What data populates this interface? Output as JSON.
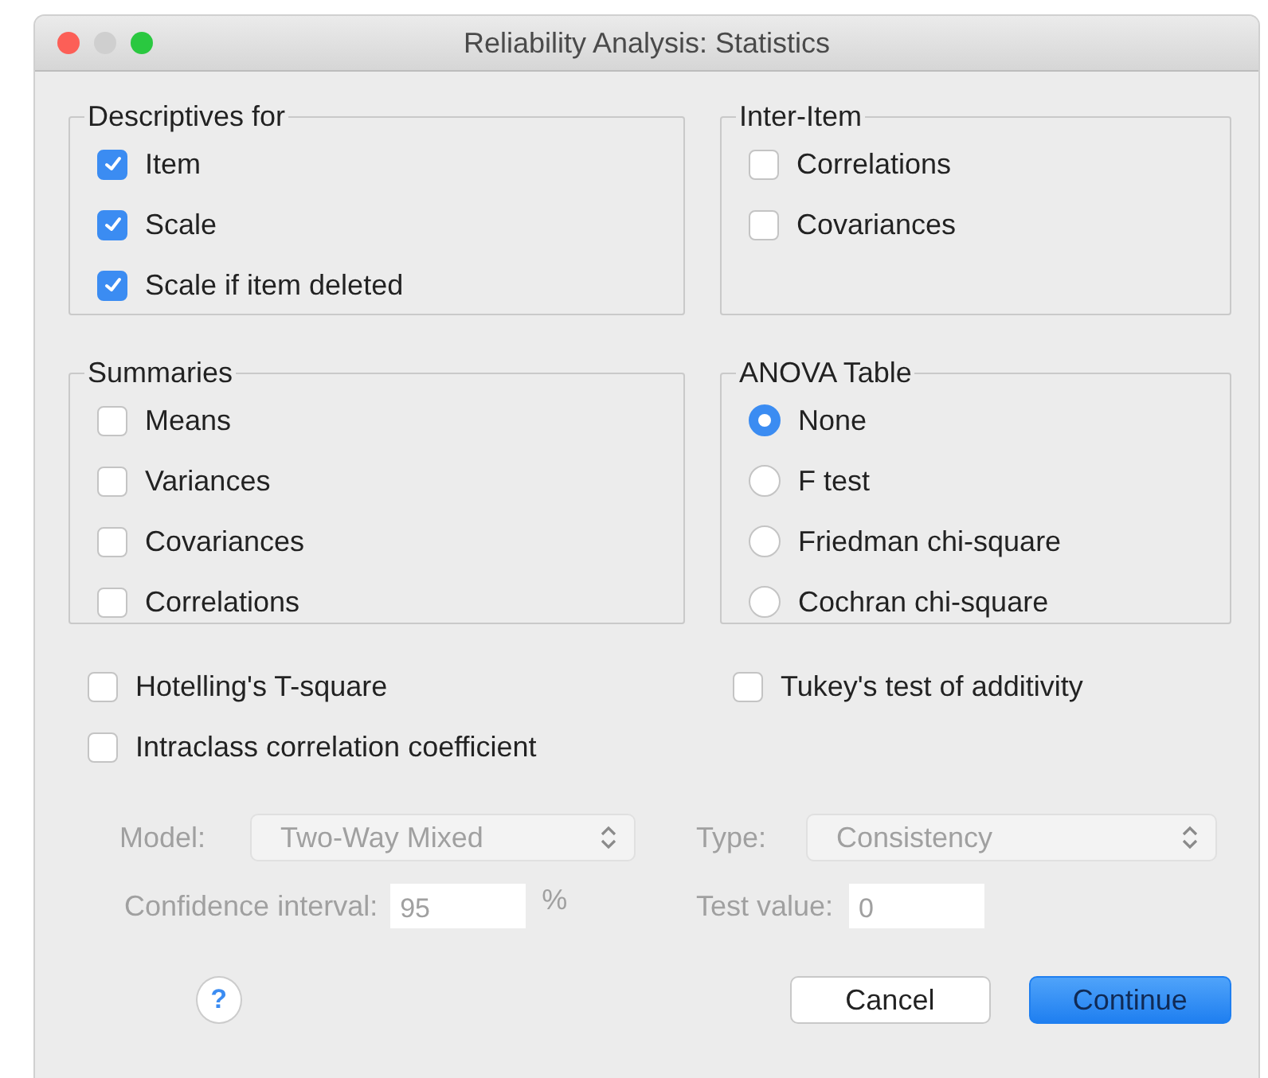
{
  "window": {
    "title": "Reliability Analysis: Statistics"
  },
  "groups": [
    {
      "title": "Descriptives for",
      "kind": "checkbox",
      "items": [
        {
          "label": "Item",
          "checked": true
        },
        {
          "label": "Scale",
          "checked": true
        },
        {
          "label": "Scale if item deleted",
          "checked": true
        }
      ]
    },
    {
      "title": "Inter-Item",
      "kind": "checkbox",
      "items": [
        {
          "label": "Correlations",
          "checked": false
        },
        {
          "label": "Covariances",
          "checked": false
        }
      ]
    },
    {
      "title": "Summaries",
      "kind": "checkbox",
      "items": [
        {
          "label": "Means",
          "checked": false
        },
        {
          "label": "Variances",
          "checked": false
        },
        {
          "label": "Covariances",
          "checked": false
        },
        {
          "label": "Correlations",
          "checked": false
        }
      ]
    },
    {
      "title": "ANOVA Table",
      "kind": "radio",
      "items": [
        {
          "label": "None",
          "selected": true
        },
        {
          "label": "F test",
          "selected": false
        },
        {
          "label": "Friedman chi-square",
          "selected": false
        },
        {
          "label": "Cochran chi-square",
          "selected": false
        }
      ]
    }
  ],
  "options": [
    {
      "label": "Hotelling's T-square",
      "checked": false
    },
    {
      "label": "Tukey's test of additivity",
      "checked": false
    },
    {
      "label": "Intraclass correlation coefficient",
      "checked": false
    }
  ],
  "icc": {
    "disabled": true,
    "model": {
      "label": "Model:",
      "value": "Two-Way Mixed"
    },
    "type": {
      "label": "Type:",
      "value": "Consistency"
    },
    "confidence": {
      "label": "Confidence interval:",
      "value": "95",
      "unit": "%"
    },
    "test_value": {
      "label": "Test value:",
      "value": "0"
    }
  },
  "help": {
    "symbol": "?"
  },
  "buttons": [
    {
      "label": "Cancel",
      "default": false
    },
    {
      "label": "Continue",
      "default": true
    }
  ]
}
